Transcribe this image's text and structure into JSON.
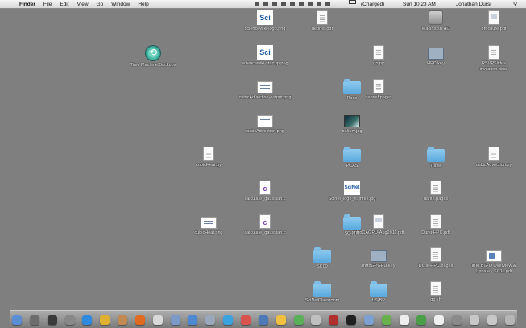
{
  "menubar": {
    "apple": "",
    "app_name": "Finder",
    "menus": [
      "File",
      "Edit",
      "View",
      "Go",
      "Window",
      "Help"
    ],
    "extras_icons": [
      "dropbox-icon",
      "scanner-icon",
      "screen-icon",
      "cloud-icon",
      "sync-icon",
      "timemachine-icon",
      "bluetooth-icon",
      "wifi-icon",
      "volume-icon"
    ],
    "battery": "(Charged)",
    "clock": "Sun 10:23 AM",
    "user": "Jonathan Dursi",
    "spotlight": "⚲"
  },
  "desktop": [
    {
      "name": "sciencewiki-logo",
      "label": "sciencewiki-logo.png",
      "kind": "sci",
      "glyph": "Sci"
    },
    {
      "name": "debrief-pdf",
      "label": "debrief.pdf",
      "kind": "doc"
    },
    {
      "name": "macintosh-hd",
      "label": "Macintosh HD",
      "kind": "drive"
    },
    {
      "name": "brochure-pdf",
      "label": "brochure.pdf",
      "kind": "pdf"
    },
    {
      "name": "time-machine",
      "label": "Time Machine Backups",
      "kind": "tm"
    },
    {
      "name": "sciencewiki-startup",
      "label": "sciencewiki-startup.png",
      "kind": "sci",
      "glyph": "Sci"
    },
    {
      "name": "go-py",
      "label": "go.py",
      "kind": "doc"
    },
    {
      "name": "hpc-key",
      "label": "HPC.key",
      "kind": "key"
    },
    {
      "name": "rsvp-invitation",
      "label": "RSVPSlides invitation.docx",
      "kind": "doc"
    },
    {
      "name": "cubicadvection-output",
      "label": "cubicAdvection-output.png",
      "kind": "img"
    },
    {
      "name": "folder-paris",
      "label": "Paris",
      "kind": "folder"
    },
    {
      "name": "debrief-pages",
      "label": "debrief.pages",
      "kind": "doc"
    },
    {
      "name": "cubicadvection-png",
      "label": "cubicAdvection.png",
      "kind": "img"
    },
    {
      "name": "bakery-jpg",
      "label": "bakery.jpg",
      "kind": "photo"
    },
    {
      "name": "cubicheat-py",
      "label": "cubicHeat.py",
      "kind": "doc"
    },
    {
      "name": "folder-pcas",
      "label": "PCAS",
      "kind": "folder"
    },
    {
      "name": "folder-travel",
      "label": "Travel",
      "kind": "folder"
    },
    {
      "name": "cubicadvection-py",
      "label": "cubicAdvection.py",
      "kind": "doc"
    },
    {
      "name": "calculate-gaussian-c",
      "label": "calculate_gaussian.c",
      "kind": "c",
      "glyph": "c"
    },
    {
      "name": "scinet-logo",
      "label": "Scinet_logo_highres.jpg",
      "kind": "sci",
      "glyph": "SciNet"
    },
    {
      "name": "dante-pages",
      "label": "dante.pages",
      "kind": "doc"
    },
    {
      "name": "cubicheat-png",
      "label": "cubicHeat.png",
      "kind": "img"
    },
    {
      "name": "calculate-gaussian-c2",
      "label": "calculate_gaussian.c",
      "kind": "c",
      "glyph": "c"
    },
    {
      "name": "folder-sc-mpi",
      "label": "SC-MPI",
      "kind": "folder"
    },
    {
      "name": "intro-cagpu-pdf",
      "label": "IntroCAGPU-Aug2011.pdf",
      "kind": "pdf"
    },
    {
      "name": "dursi-hpc-pdf",
      "label": "Dursi-HPC.pdf",
      "kind": "doc"
    },
    {
      "name": "folder-sc09",
      "label": "SC09",
      "kind": "folder"
    },
    {
      "name": "intro-gpgpu-key",
      "label": "IntroGPGPU.key",
      "kind": "key"
    },
    {
      "name": "dursi-hpc-pages",
      "label": "Dursi-HPC.pages",
      "kind": "doc"
    },
    {
      "name": "ibm-bgq-pdf",
      "label": "IBM BG-Q Overview & Update - SC11.pdf",
      "kind": "ppt"
    },
    {
      "name": "folder-scinetclassroom",
      "label": "SciNetClassroom",
      "kind": "folder"
    },
    {
      "name": "folder-ls-bp",
      "label": "LS-BP",
      "kind": "folder"
    },
    {
      "name": "go-sh",
      "label": "go.sh",
      "kind": "doc"
    }
  ],
  "dock": {
    "items": [
      {
        "name": "finder-icon",
        "color": "#5a8fd8"
      },
      {
        "name": "mail-stamp-icon",
        "color": "#6d6d6d"
      },
      {
        "name": "photobooth-icon",
        "color": "#3b3b3b"
      },
      {
        "name": "launchpad-icon",
        "color": "#888888"
      },
      {
        "name": "safari-icon",
        "color": "#2f8be0"
      },
      {
        "name": "chrome-icon",
        "color": "#e0b030"
      },
      {
        "name": "addressbook-icon",
        "color": "#c08a50"
      },
      {
        "name": "firefox-icon",
        "color": "#e06a20"
      },
      {
        "name": "ical-icon",
        "color": "#d9d9d9"
      },
      {
        "name": "iphoto-icon",
        "color": "#7a9ac8"
      },
      {
        "name": "itunes-icon",
        "color": "#4d8ad0"
      },
      {
        "name": "preview-icon",
        "color": "#9aa9b9"
      },
      {
        "name": "skype-icon",
        "color": "#3aa3e0"
      },
      {
        "name": "ical2-icon",
        "color": "#d9534f"
      },
      {
        "name": "keynote-icon",
        "color": "#4e79b8"
      },
      {
        "name": "pages-icon",
        "color": "#f0c040"
      },
      {
        "name": "numbers-icon",
        "color": "#5ab05a"
      },
      {
        "name": "netnewswire-icon",
        "color": "#c0c0c0"
      },
      {
        "name": "acrobat-icon",
        "color": "#b03030"
      },
      {
        "name": "terminal-icon",
        "color": "#202020"
      },
      {
        "name": "xcode-icon",
        "color": "#7da0d0"
      },
      {
        "name": "omnigraffle-icon",
        "color": "#6ab04c"
      },
      {
        "name": "x11-icon",
        "color": "#eeeeee"
      },
      {
        "name": "activity-icon",
        "color": "#4aa04a"
      },
      {
        "name": "textedit-icon",
        "color": "#f0f0f0"
      },
      {
        "name": "systemprefs-icon",
        "color": "#8a8a8a"
      },
      {
        "name": "downloads-stack-icon",
        "color": "#c8c8c8"
      },
      {
        "name": "documents-stack-icon",
        "color": "#c8c8c8"
      },
      {
        "name": "trash-icon",
        "color": "#b5b5b5"
      }
    ]
  }
}
